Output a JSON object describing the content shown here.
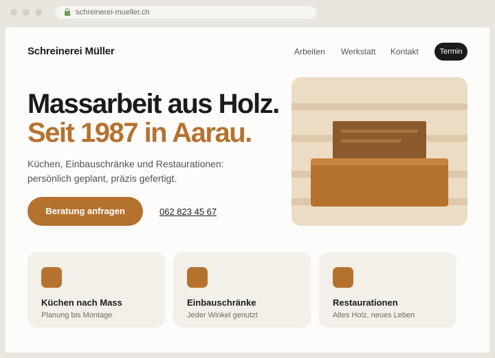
{
  "browser": {
    "url": "schreinerei-mueller.ch"
  },
  "header": {
    "brand": "Schreinerei Müller",
    "nav": [
      "Arbeiten",
      "Werkstatt",
      "Kontakt"
    ],
    "cta_label": "Termin"
  },
  "hero": {
    "headline": "Massarbeit aus Holz.",
    "headline_accent": "Seit 1987 in Aarau.",
    "lead_line1": "Küchen, Einbauschränke und Restaurationen:",
    "lead_line2": "persönlich geplant, präzis gefertigt.",
    "button_label": "Beratung anfragen",
    "phone": "062 823 45 67"
  },
  "cards": [
    {
      "title": "Küchen nach Mass",
      "subtitle": "Planung bis Montage",
      "icon": "kitchen-icon"
    },
    {
      "title": "Einbauschränke",
      "subtitle": "Jeder Winkel genutzt",
      "icon": "cabinet-icon"
    },
    {
      "title": "Restaurationen",
      "subtitle": "Altes Holz, neues Leben",
      "icon": "restoration-icon"
    }
  ],
  "colors": {
    "accent": "#b5722f",
    "dark": "#1c1b1a",
    "card_bg": "#f3f0e9"
  }
}
